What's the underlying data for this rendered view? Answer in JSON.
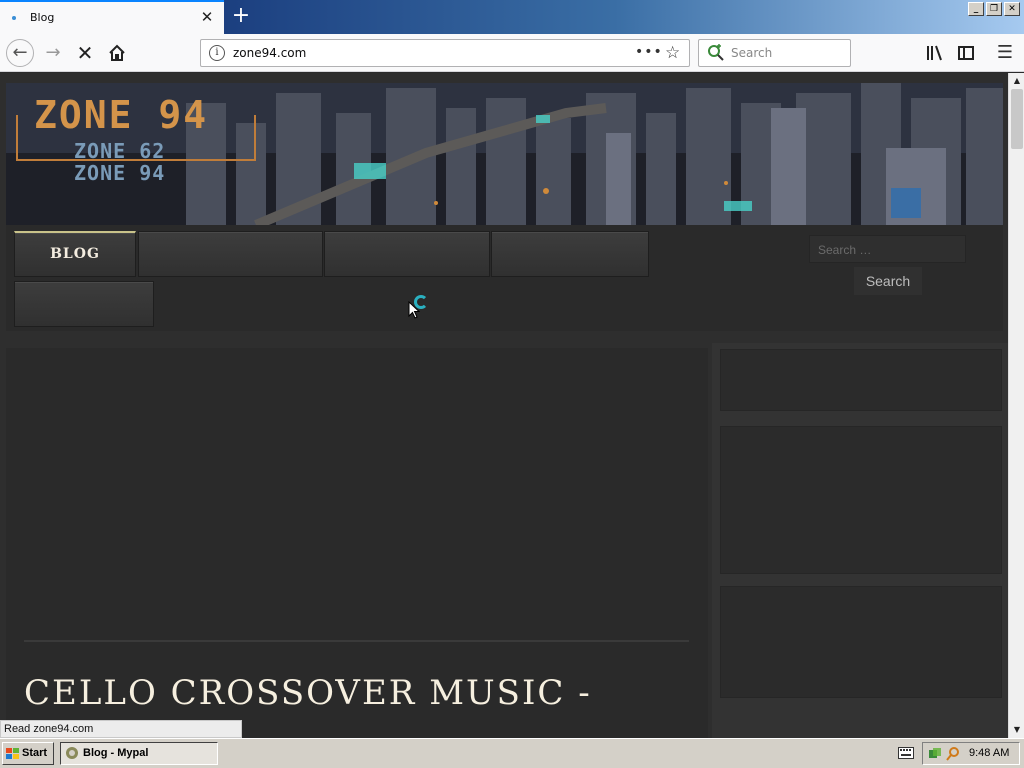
{
  "browser": {
    "tab_title": "Blog",
    "url": "zone94.com",
    "search_placeholder": "Search",
    "status_text": "Read zone94.com"
  },
  "page": {
    "logo_main": "ZONE 94",
    "logo_sub_1": "ZONE 62",
    "logo_sub_2": "ZONE 94",
    "menu": [
      {
        "label": "BLOG"
      },
      {
        "label": ""
      },
      {
        "label": ""
      },
      {
        "label": ""
      },
      {
        "label": ""
      }
    ],
    "search_placeholder": "Search …",
    "search_button": "Search",
    "post_title": "CELLO CROSSOVER MUSIC -"
  },
  "taskbar": {
    "start_label": "Start",
    "task_label": "Blog - Mypal",
    "clock": "9:48 AM"
  },
  "colors": {
    "accent_tab": "#0a84ff",
    "logo_orange": "#d4944a",
    "logo_blue": "#7a9bb8",
    "menu_active_border": "#c9c38a",
    "spinner": "#2ab0c0"
  },
  "icons": [
    "back-arrow-icon",
    "forward-arrow-icon",
    "stop-icon",
    "home-icon",
    "info-icon",
    "more-icon",
    "bookmark-star-icon",
    "search-icon",
    "library-icon",
    "sidebar-icon",
    "hamburger-menu-icon",
    "close-icon",
    "plus-icon",
    "windows-flag-icon",
    "keyboard-icon"
  ]
}
